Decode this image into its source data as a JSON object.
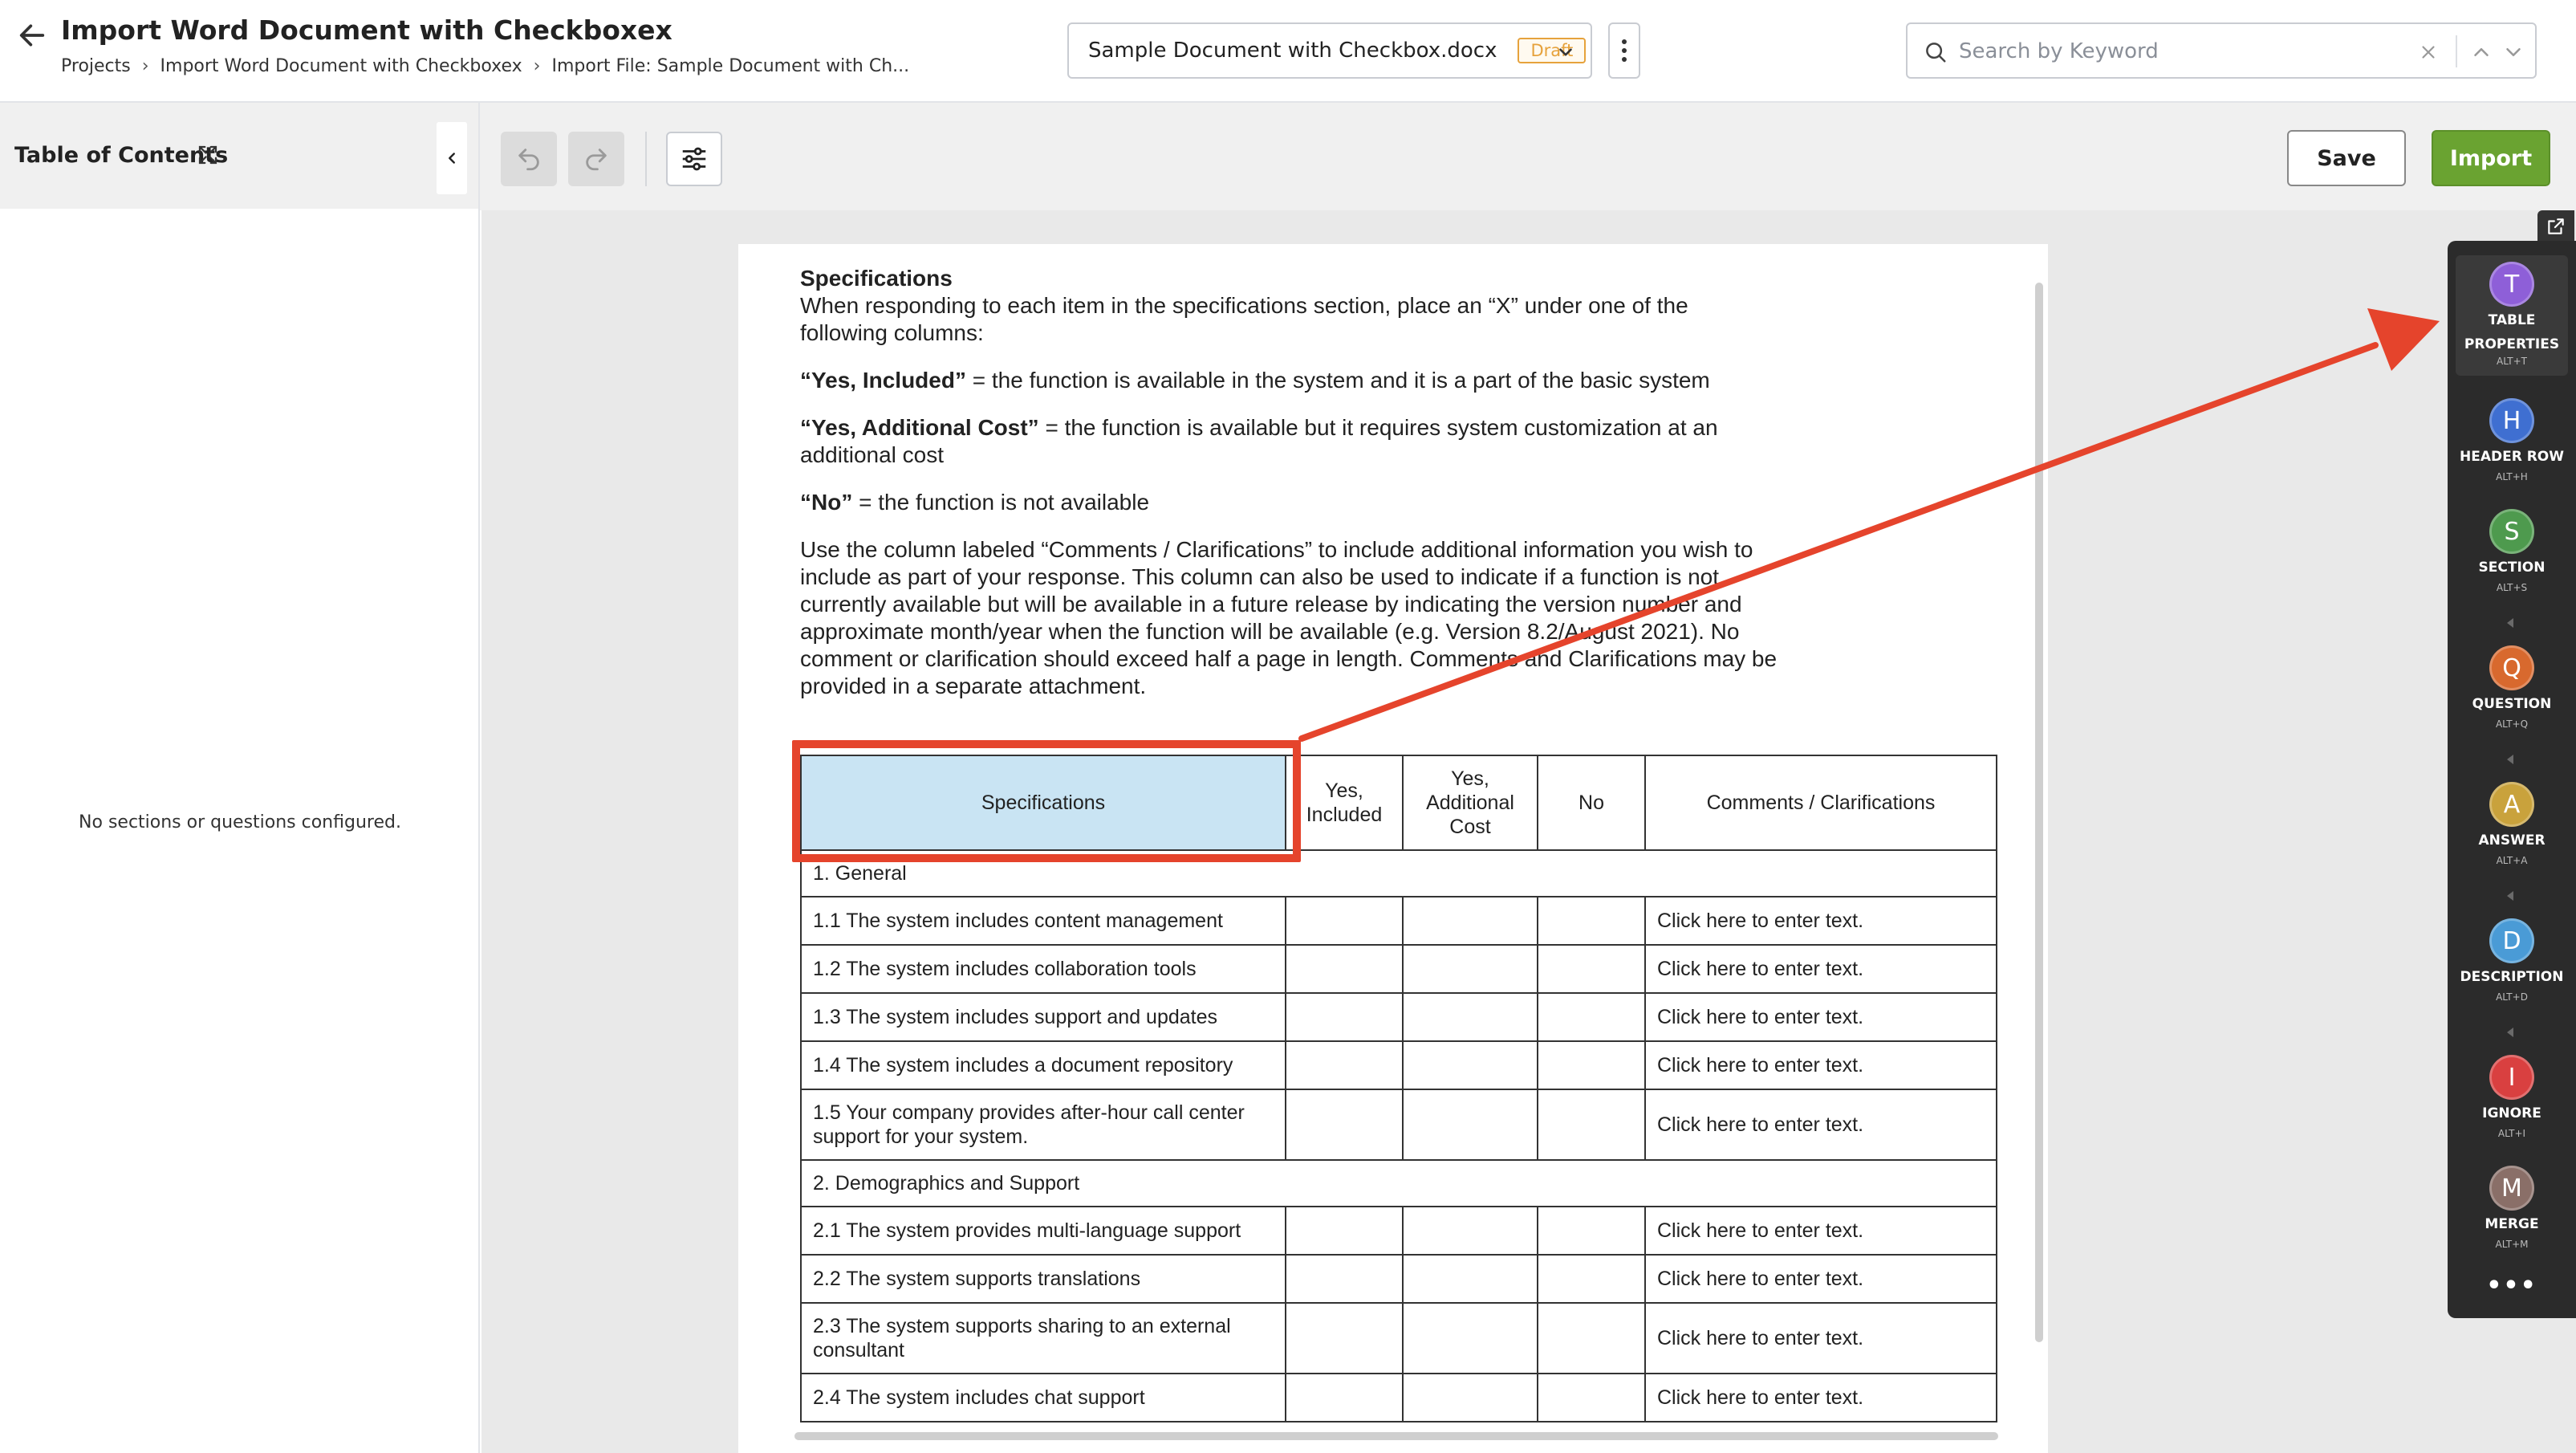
{
  "header": {
    "title": "Import Word Document with Checkboxex",
    "breadcrumbs": [
      "Projects",
      "Import Word Document with Checkboxex",
      "Import File:  Sample Document with Ch..."
    ],
    "document": {
      "name": "Sample Document with Checkbox.docx",
      "status": "Draft"
    },
    "search": {
      "placeholder": "Search by Keyword",
      "value": ""
    }
  },
  "toc": {
    "title": "Table of Contents",
    "empty_message": "No sections or questions configured."
  },
  "toolbar": {
    "save_label": "Save",
    "import_label": "Import"
  },
  "document_body": {
    "heading": "Specifications",
    "intro": "When responding to each item in the specifications section, place an “X” under one of the following columns:",
    "definitions": [
      {
        "term": "“Yes, Included”",
        "text": " = the function is available in the system and it is a part of the basic system"
      },
      {
        "term": "“Yes, Additional Cost”",
        "text": " = the function is available but it requires system customization at an additional cost"
      },
      {
        "term": "“No”",
        "text": " = the function is not available"
      }
    ],
    "instructions": "Use the column labeled “Comments / Clarifications” to include additional information you wish to include as part of your response. This column can also be used to indicate if a function is not currently available but will be available in a future release by indicating the version number and approximate month/year when the function will be available (e.g. Version 8.2/August 2021). No comment or clarification should exceed half a page in length. Comments and Clarifications may be provided in a separate attachment."
  },
  "table": {
    "columns": [
      "Specifications",
      "Yes, Included",
      "Yes, Additional Cost",
      "No",
      "Comments / Clarifications"
    ],
    "sections": [
      {
        "title": "1. General",
        "rows": [
          {
            "spec": "1.1 The system includes content management",
            "comment": "Click here to enter text."
          },
          {
            "spec": "1.2 The system includes collaboration tools",
            "comment": "Click here to enter text."
          },
          {
            "spec": "1.3 The system includes support and updates",
            "comment": "Click here to enter text."
          },
          {
            "spec": "1.4 The system includes a document repository",
            "comment": "Click here to enter text."
          },
          {
            "spec": "1.5 Your company provides after-hour call center support for your system.",
            "comment": "Click here to enter text."
          }
        ]
      },
      {
        "title": "2. Demographics and Support",
        "rows": [
          {
            "spec": "2.1 The system provides multi-language support",
            "comment": "Click here to enter text."
          },
          {
            "spec": "2.2 The system supports translations",
            "comment": "Click here to enter text."
          },
          {
            "spec": "2.3 The system supports sharing to an external consultant",
            "comment": "Click here to enter text."
          },
          {
            "spec": "2.4 The system includes chat support",
            "comment": "Click here to enter text."
          }
        ]
      }
    ]
  },
  "rail": {
    "items": [
      {
        "letter": "T",
        "label1": "TABLE",
        "label2": "PROPERTIES",
        "shortcut": "ALT+T",
        "color": "#8e5fd8"
      },
      {
        "letter": "H",
        "label1": "HEADER ROW",
        "shortcut": "ALT+H",
        "color": "#3f6fd1"
      },
      {
        "letter": "S",
        "label1": "SECTION",
        "shortcut": "ALT+S",
        "color": "#4e9a4e"
      },
      {
        "letter": "Q",
        "label1": "QUESTION",
        "shortcut": "ALT+Q",
        "color": "#d8692e"
      },
      {
        "letter": "A",
        "label1": "ANSWER",
        "shortcut": "ALT+A",
        "color": "#c9a23c"
      },
      {
        "letter": "D",
        "label1": "DESCRIPTION",
        "shortcut": "ALT+D",
        "color": "#4a9bd6"
      },
      {
        "letter": "I",
        "label1": "IGNORE",
        "shortcut": "ALT+I",
        "color": "#d94040"
      },
      {
        "letter": "M",
        "label1": "MERGE",
        "shortcut": "ALT+M",
        "color": "#8a6f68"
      }
    ],
    "more": "•••"
  },
  "colors": {
    "accent_import": "#6aa331",
    "highlight": "#e5442c",
    "draft": "#e6a23c",
    "rail_bg": "#2b2b2b",
    "header_cell": "#c9e4f3"
  }
}
